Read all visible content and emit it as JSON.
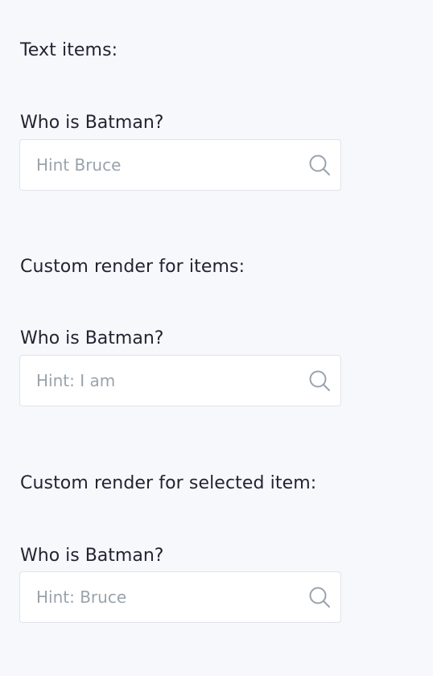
{
  "sections": [
    {
      "title": "Text items:",
      "label": "Who is Batman?",
      "placeholder": "Hint Bruce",
      "search_icon": "search-icon"
    },
    {
      "title": "Custom render for items:",
      "label": "Who is Batman?",
      "placeholder": "Hint: I am",
      "search_icon": "search-icon"
    },
    {
      "title": "Custom render for selected item:",
      "label": "Who is Batman?",
      "placeholder": "Hint: Bruce",
      "search_icon": "search-icon"
    }
  ],
  "colors": {
    "background": "#f7f8fb",
    "input_border": "#dfe3ea",
    "placeholder": "#98a3ad",
    "icon": "#98a3ad",
    "text": "#1f2430"
  }
}
